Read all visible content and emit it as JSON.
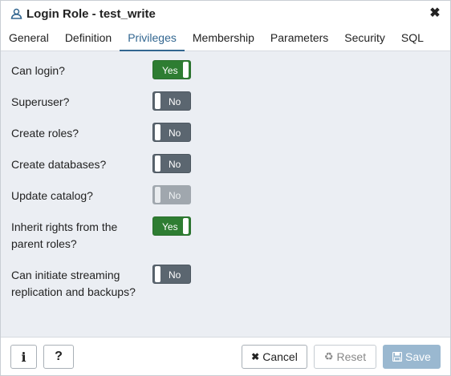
{
  "dialog": {
    "title": "Login Role - test_write",
    "close_icon": "close-icon"
  },
  "tabs": [
    {
      "label": "General",
      "active": false
    },
    {
      "label": "Definition",
      "active": false
    },
    {
      "label": "Privileges",
      "active": true
    },
    {
      "label": "Membership",
      "active": false
    },
    {
      "label": "Parameters",
      "active": false
    },
    {
      "label": "Security",
      "active": false
    },
    {
      "label": "SQL",
      "active": false
    }
  ],
  "privileges": [
    {
      "label": "Can login?",
      "value": "Yes",
      "state": "on"
    },
    {
      "label": "Superuser?",
      "value": "No",
      "state": "off"
    },
    {
      "label": "Create roles?",
      "value": "No",
      "state": "off"
    },
    {
      "label": "Create databases?",
      "value": "No",
      "state": "off"
    },
    {
      "label": "Update catalog?",
      "value": "No",
      "state": "disabled"
    },
    {
      "label": "Inherit rights from the parent roles?",
      "value": "Yes",
      "state": "on"
    },
    {
      "label": "Can initiate streaming replication and backups?",
      "value": "No",
      "state": "off"
    }
  ],
  "footer": {
    "info_label": "i",
    "help_label": "?",
    "cancel_label": "Cancel",
    "reset_label": "Reset",
    "save_label": "Save"
  },
  "colors": {
    "accent": "#326690",
    "toggle_on": "#2e7d32",
    "toggle_off": "#5b6670",
    "toggle_disabled": "#a0a7ae",
    "save_disabled": "#9ab8d0",
    "panel_bg": "#ebeef3"
  }
}
